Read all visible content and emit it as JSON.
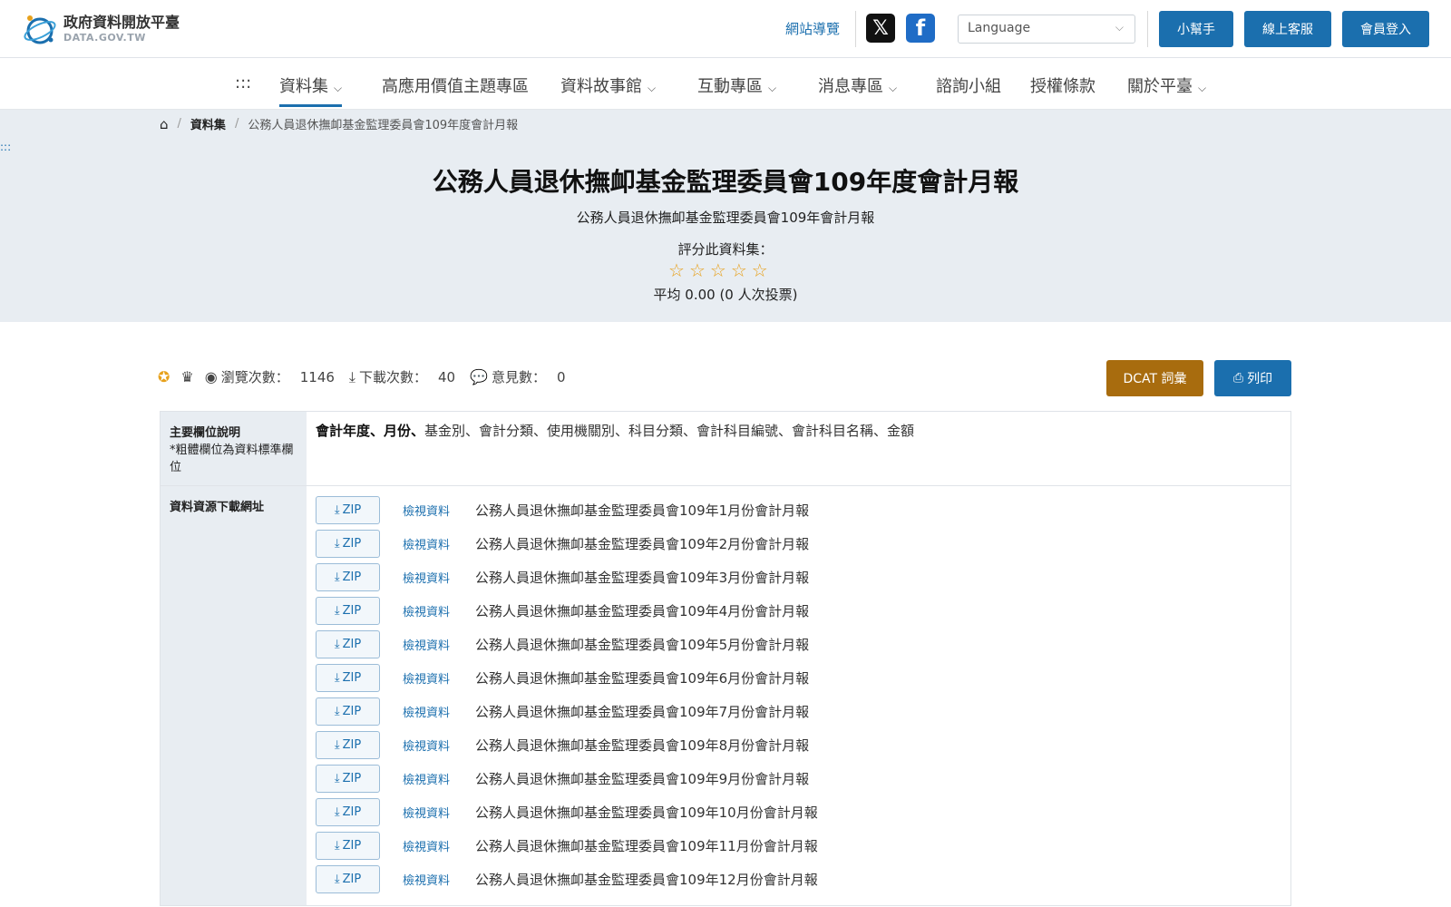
{
  "header": {
    "logo_title": "政府資料開放平臺",
    "logo_sub": "DATA.GOV.TW",
    "site_guide": "網站導覽",
    "social_x_icon": "x-icon",
    "social_fb_icon": "facebook-icon",
    "language_placeholder": "Language",
    "helper_button": "小幫手",
    "support_button": "線上客服",
    "login_button": "會員登入"
  },
  "nav": {
    "skip": ":::",
    "items": [
      {
        "label": "資料集",
        "has_caret": true
      },
      {
        "label": "高應用價值主題專區",
        "has_caret": false
      },
      {
        "label": "資料故事館",
        "has_caret": true
      },
      {
        "label": "互動專區",
        "has_caret": true
      },
      {
        "label": "消息專區",
        "has_caret": true
      },
      {
        "label": "諮詢小組",
        "has_caret": false
      },
      {
        "label": "授權條款",
        "has_caret": false
      },
      {
        "label": "關於平臺",
        "has_caret": true
      }
    ]
  },
  "breadcrumb": {
    "datasets": "資料集",
    "current": "公務人員退休撫卹基金監理委員會109年度會計月報"
  },
  "hero": {
    "skip": ":::",
    "title": "公務人員退休撫卹基金監理委員會109年度會計月報",
    "description": "公務人員退休撫卹基金監理委員會109年會計月報",
    "rate_label": "評分此資料集：",
    "rating": 0,
    "average_text": "平均 0.00 (0 人次投票)"
  },
  "stats": {
    "views_label": "瀏覽次數：",
    "views": "1146",
    "downloads_label": "下載次數：",
    "downloads": "40",
    "comments_label": "意見數：",
    "comments": "0",
    "dcat_button": "DCAT 詞彙",
    "print_button": "列印"
  },
  "table": {
    "fields_label": "主要欄位說明",
    "fields_note": "*粗體欄位為資料標準欄位",
    "fields_bold": "會計年度、月份、",
    "fields_rest": "基金別、會計分類、使用機關別、科目分類、會計科目編號、會計科目名稱、金額",
    "resources_label": "資料資源下載網址",
    "zip_label": "ZIP",
    "view_label": "檢視資料",
    "resources": [
      "公務人員退休撫卹基金監理委員會109年1月份會計月報",
      "公務人員退休撫卹基金監理委員會109年2月份會計月報",
      "公務人員退休撫卹基金監理委員會109年3月份會計月報",
      "公務人員退休撫卹基金監理委員會109年4月份會計月報",
      "公務人員退休撫卹基金監理委員會109年5月份會計月報",
      "公務人員退休撫卹基金監理委員會109年6月份會計月報",
      "公務人員退休撫卹基金監理委員會109年7月份會計月報",
      "公務人員退休撫卹基金監理委員會109年8月份會計月報",
      "公務人員退休撫卹基金監理委員會109年9月份會計月報",
      "公務人員退休撫卹基金監理委員會109年10月份會計月報",
      "公務人員退休撫卹基金監理委員會109年11月份會計月報",
      "公務人員退休撫卹基金監理委員會109年12月份會計月報"
    ]
  },
  "colors": {
    "primary": "#1b6fae",
    "dcat": "#a86c0e",
    "hero_bg": "#e8edf2",
    "star": "#e7a11c"
  }
}
